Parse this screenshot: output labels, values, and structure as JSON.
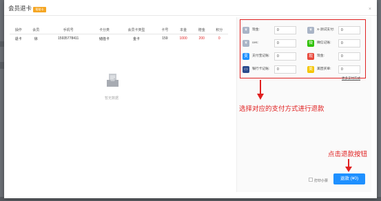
{
  "modal": {
    "title": "会员退卡",
    "tag": "帮助卡",
    "close": "×"
  },
  "table": {
    "headers": [
      "操作",
      "会员",
      "手机号",
      "卡分类",
      "会员卡类型",
      "卡号",
      "本金",
      "赠金",
      "积分"
    ],
    "rows": [
      {
        "op": "退卡",
        "member": "徐",
        "phone": "15935778411",
        "category": "储值卡",
        "type": "金卡",
        "card": "159",
        "principal": "1000",
        "bonus": "200",
        "points": "0"
      }
    ]
  },
  "empty": {
    "text": "暂无数据"
  },
  "payments": [
    {
      "icon": "¥",
      "label": "现金:",
      "value": "0",
      "color": "#a9b4c6"
    },
    {
      "icon": "¥",
      "label": "X-测试支付:",
      "value": "0",
      "color": "#a9b4c6"
    },
    {
      "icon": "¥",
      "label": "ces:",
      "value": "0",
      "color": "#a9b4c6"
    },
    {
      "icon": "微",
      "label": "微信记账:",
      "value": "0",
      "color": "#2dc100"
    },
    {
      "icon": "支",
      "label": "支付宝记账:",
      "value": "0",
      "color": "#1e90ff"
    },
    {
      "icon": "现",
      "label": "现金:",
      "value": "0",
      "color": "#e8483b"
    },
    {
      "icon": "▭",
      "label": "银行卡记账:",
      "value": "0",
      "color": "#2b4a8c"
    },
    {
      "icon": "美",
      "label": "美团买单:",
      "value": "0",
      "color": "#f5c500"
    }
  ],
  "more_payment": "更多支付方式",
  "annotations": {
    "choose": "选择对应的支付方式进行退款",
    "click": "点击退款按钮"
  },
  "footer": {
    "print_label": "打印小票",
    "refund_button": "退款 (¥0)"
  }
}
